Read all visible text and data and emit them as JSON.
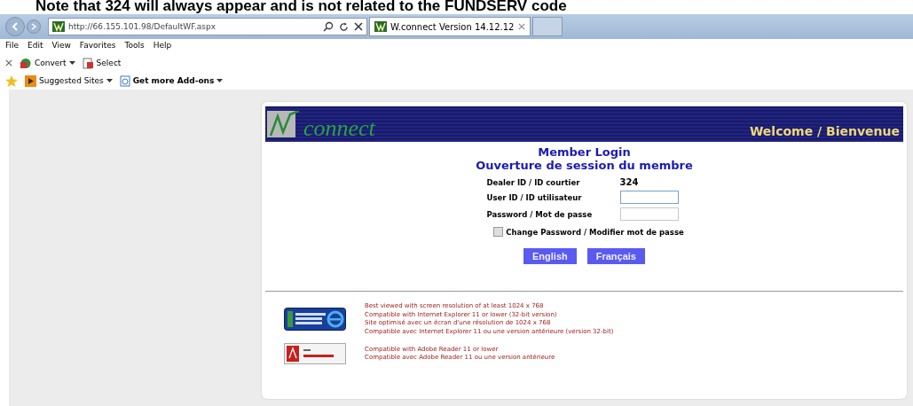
{
  "note": "Note that 324 will always appear and is not related to the FUNDSERV code",
  "browser": {
    "address": "http://66.155.101.98/DefaultWF.aspx",
    "tabs": [
      {
        "label": "W.connect Version 14.12.12",
        "selected": true
      }
    ],
    "menu": [
      "File",
      "Edit",
      "View",
      "Favorites",
      "Tools",
      "Help"
    ],
    "commands": [
      {
        "label": "Convert",
        "kind": "convert"
      },
      {
        "label": "Select",
        "kind": "select"
      }
    ],
    "favorites": [
      {
        "label": "Suggested Sites",
        "kind": "suggested"
      },
      {
        "label": "Get more Add-ons",
        "kind": "addons"
      }
    ]
  },
  "page": {
    "logo": "connect",
    "welcome": "Welcome / Bienvenue",
    "title": "Member Login",
    "subtitle": "Ouverture de session du membre",
    "fields": [
      {
        "label": "Dealer ID / ID courtier",
        "kind": "static",
        "value": "324"
      },
      {
        "label": "User ID / ID utilisateur",
        "kind": "input",
        "focused": true
      },
      {
        "label": "Password / Mot de passe",
        "kind": "input",
        "focused": false
      }
    ],
    "checkbox": {
      "label": "Change Password / Modifier mot de passe",
      "checked": false
    },
    "buttons": [
      "English",
      "Français"
    ],
    "notices": [
      {
        "kind": "ie",
        "lines": [
          "Best viewed with screen resolution of at least 1024 x 768",
          "Compatible with Internet Explorer 11 or lower (32-bit version)",
          "Site optimisé avec un écran d'une résolution de 1024 x 768",
          "Compatible avec Internet Explorer 11 ou une version antérieure (version 32-bit)"
        ]
      },
      {
        "kind": "pdf",
        "lines": [
          "Compatible with Adobe Reader 11 or lower",
          "Compatible avec Adobe Reader 11 ou une version antérieure"
        ]
      }
    ]
  }
}
